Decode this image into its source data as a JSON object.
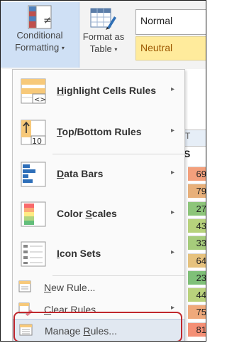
{
  "ribbon": {
    "conditional_formatting": {
      "line1": "Conditional",
      "line2": "Formatting",
      "caret": "▾"
    },
    "format_as_table": {
      "line1": "Format as",
      "line2": "Table",
      "caret": "▾"
    },
    "styles": {
      "normal": "Normal",
      "neutral": "Neutral"
    }
  },
  "menu": {
    "items": [
      {
        "label": "Highlight Cells Rules",
        "access_key": "H",
        "rest": "ighlight Cells Rules",
        "submenu": "▸",
        "icon": "highlight-cells-rules-icon"
      },
      {
        "label": "Top/Bottom Rules",
        "access_key": "T",
        "rest": "op/Bottom Rules",
        "submenu": "▸",
        "icon": "top-bottom-rules-icon",
        "icon_text": "10"
      },
      {
        "label": "Data Bars",
        "access_key": "D",
        "rest": "ata Bars",
        "submenu": "▸",
        "icon": "data-bars-icon"
      },
      {
        "label": "Color Scales",
        "access_key": "S",
        "pre": "Color ",
        "rest": "cales",
        "submenu": "▸",
        "icon": "color-scales-icon"
      },
      {
        "label": "Icon Sets",
        "access_key": "I",
        "rest": "con Sets",
        "submenu": "▸",
        "icon": "icon-sets-icon"
      },
      {
        "label": "New Rule...",
        "access_key": "N",
        "rest": "ew Rule...",
        "icon": "new-rule-icon"
      },
      {
        "label": "Clear Rules",
        "access_key": "C",
        "rest": "lear Rules",
        "submenu": "▸",
        "icon": "clear-rules-icon"
      },
      {
        "label": "Manage Rules...",
        "access_key": "R",
        "pre": "Manage ",
        "rest": "ules...",
        "icon": "manage-rules-icon",
        "selected": true
      }
    ]
  },
  "sheet": {
    "column_fragment": "T",
    "header_fragment": "S",
    "values": [
      "69",
      "79",
      "27",
      "43",
      "33",
      "64",
      "23",
      "44",
      "75",
      "81"
    ],
    "colors": [
      "#f3a07c",
      "#e8b07a",
      "#8dc57a",
      "#b7d27c",
      "#a6cc7b",
      "#e6c27e",
      "#7fc078",
      "#b9d27c",
      "#efa97b",
      "#f48f75"
    ]
  },
  "colors": {
    "callout": "#c0272d",
    "menu_selected": "#e1e8f1",
    "neutral_fill": "#ffeb9c"
  }
}
